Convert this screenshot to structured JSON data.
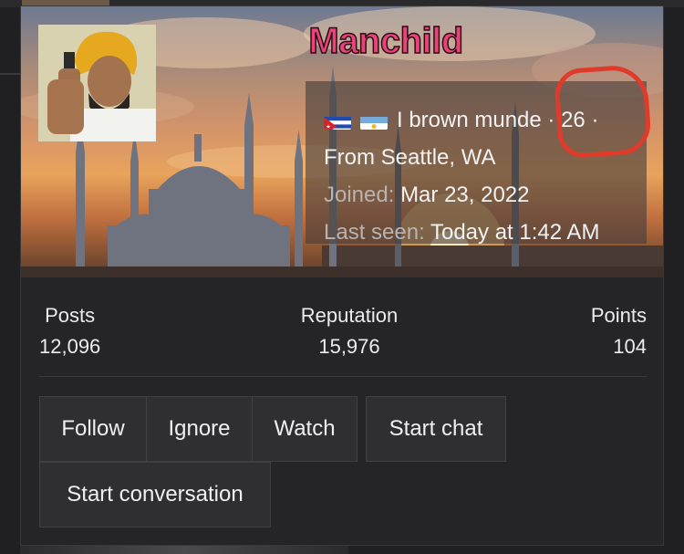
{
  "profile": {
    "username": "Manchild",
    "flags": [
      "cuba-flag",
      "argentina-flag"
    ],
    "bio": "I brown munde · 26 ·",
    "location": "From Seattle, WA",
    "joined_label": "Joined:",
    "joined_value": "Mar 23, 2022",
    "last_seen_label": "Last seen:",
    "last_seen_value": "Today at 1:42 AM"
  },
  "stats": [
    {
      "label": "Posts",
      "value": "12,096"
    },
    {
      "label": "Reputation",
      "value": "15,976"
    },
    {
      "label": "Points",
      "value": "104"
    }
  ],
  "actions": {
    "follow": "Follow",
    "ignore": "Ignore",
    "watch": "Watch",
    "start_chat": "Start chat",
    "start_conversation": "Start conversation"
  },
  "colors": {
    "username": "#e8447a",
    "annotation_circle": "#e03a2a",
    "card_bg": "#252527"
  }
}
